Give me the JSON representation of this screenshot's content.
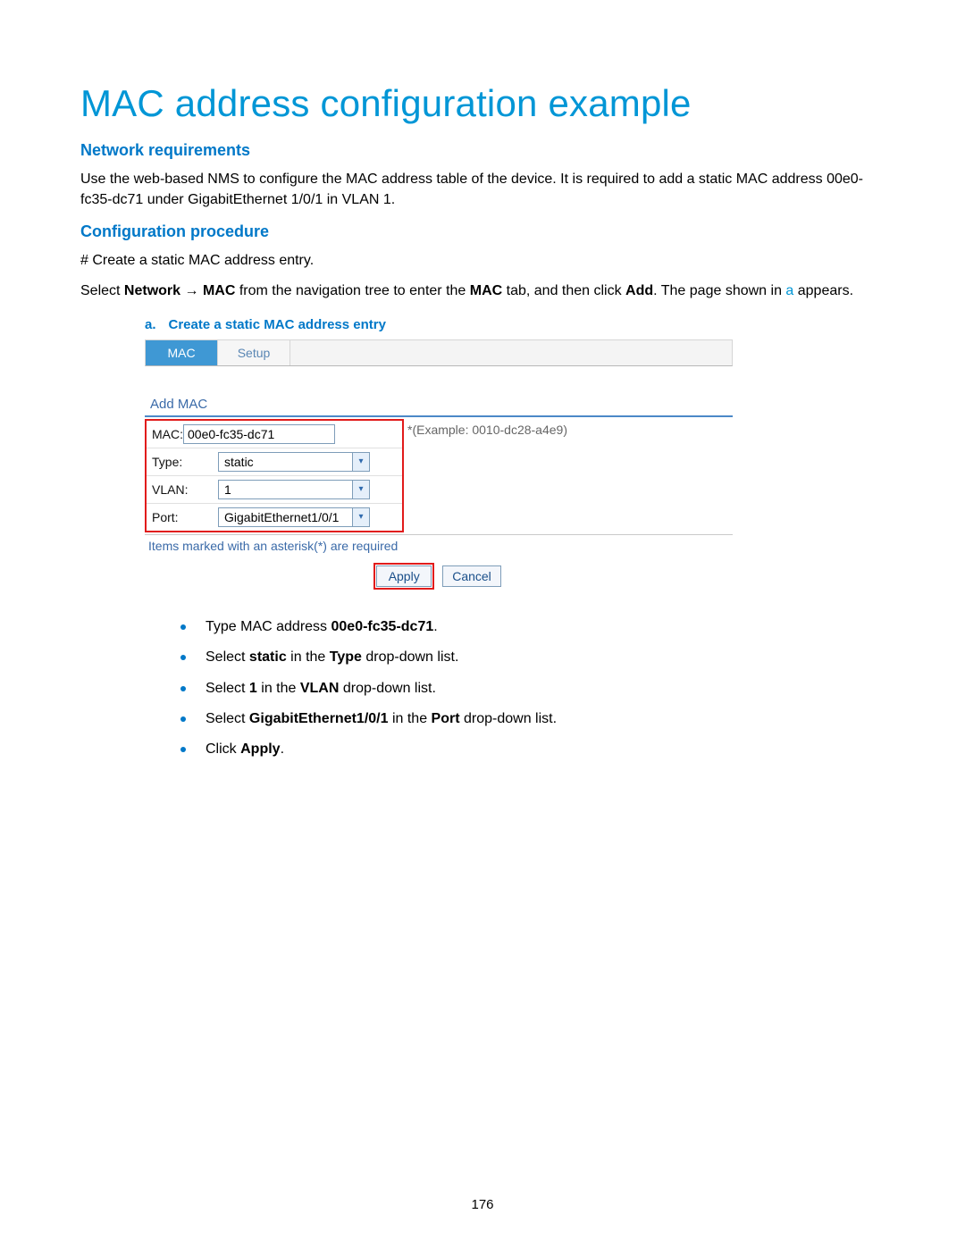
{
  "title": "MAC address configuration example",
  "sections": {
    "network_req": {
      "heading": "Network requirements",
      "body": "Use the web-based NMS to configure the MAC address table of the device. It is required to add a static MAC address 00e0-fc35-dc71 under GigabitEthernet 1/0/1 in VLAN 1."
    },
    "config_proc": {
      "heading": "Configuration procedure",
      "step_comment": "# Create a static MAC address entry.",
      "instruction_pre": "Select ",
      "instruction_nav1": "Network",
      "instruction_arrow": " → ",
      "instruction_nav2": "MAC",
      "instruction_mid": " from the navigation tree to enter the ",
      "instruction_tab": "MAC",
      "instruction_mid2": " tab, and then click ",
      "instruction_add": "Add",
      "instruction_post": ". The page shown in ",
      "instruction_link": "a",
      "instruction_end": " appears."
    }
  },
  "figure": {
    "num": "a.",
    "caption": "Create a static MAC address entry"
  },
  "screenshot": {
    "tabs": {
      "mac": "MAC",
      "setup": "Setup"
    },
    "add_mac_label": "Add MAC",
    "fields": {
      "mac": {
        "label": "MAC:",
        "value": "00e0-fc35-dc71",
        "example": "*(Example: 0010-dc28-a4e9)"
      },
      "type": {
        "label": "Type:",
        "value": "static"
      },
      "vlan": {
        "label": "VLAN:",
        "value": "1"
      },
      "port": {
        "label": "Port:",
        "value": "GigabitEthernet1/0/1"
      }
    },
    "required_note": "Items marked with an asterisk(*) are required",
    "buttons": {
      "apply": "Apply",
      "cancel": "Cancel"
    }
  },
  "steps": {
    "s1_a": "Type MAC address ",
    "s1_b": "00e0-fc35-dc71",
    "s1_c": ".",
    "s2_a": "Select ",
    "s2_b": "static",
    "s2_c": " in the ",
    "s2_d": "Type",
    "s2_e": " drop-down list.",
    "s3_a": "Select ",
    "s3_b": "1",
    "s3_c": " in the ",
    "s3_d": "VLAN",
    "s3_e": " drop-down list.",
    "s4_a": "Select ",
    "s4_b": "GigabitEthernet1/0/1",
    "s4_c": " in the ",
    "s4_d": "Port",
    "s4_e": " drop-down list.",
    "s5_a": "Click ",
    "s5_b": "Apply",
    "s5_c": "."
  },
  "page_number": "176"
}
